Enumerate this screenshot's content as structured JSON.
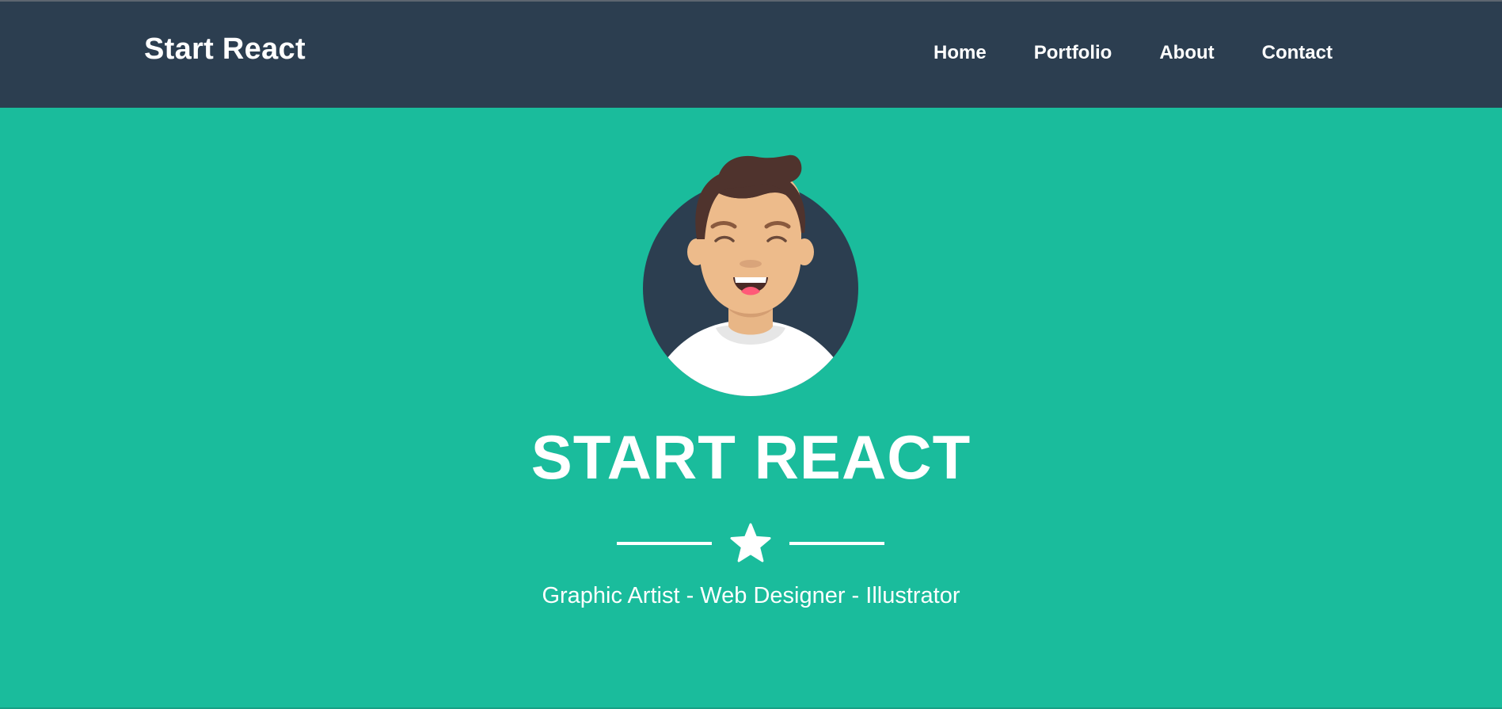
{
  "navbar": {
    "brand": "Start React",
    "links": [
      {
        "label": "Home"
      },
      {
        "label": "Portfolio"
      },
      {
        "label": "About"
      },
      {
        "label": "Contact"
      }
    ]
  },
  "hero": {
    "avatar_icon": "avatar-illustration",
    "title": "START REACT",
    "divider_icon": "star-icon",
    "subtitle": "Graphic Artist - Web Designer - Illustrator"
  },
  "colors": {
    "navbar_bg": "#2c3e50",
    "hero_bg": "#1abc9c",
    "text": "#ffffff"
  }
}
